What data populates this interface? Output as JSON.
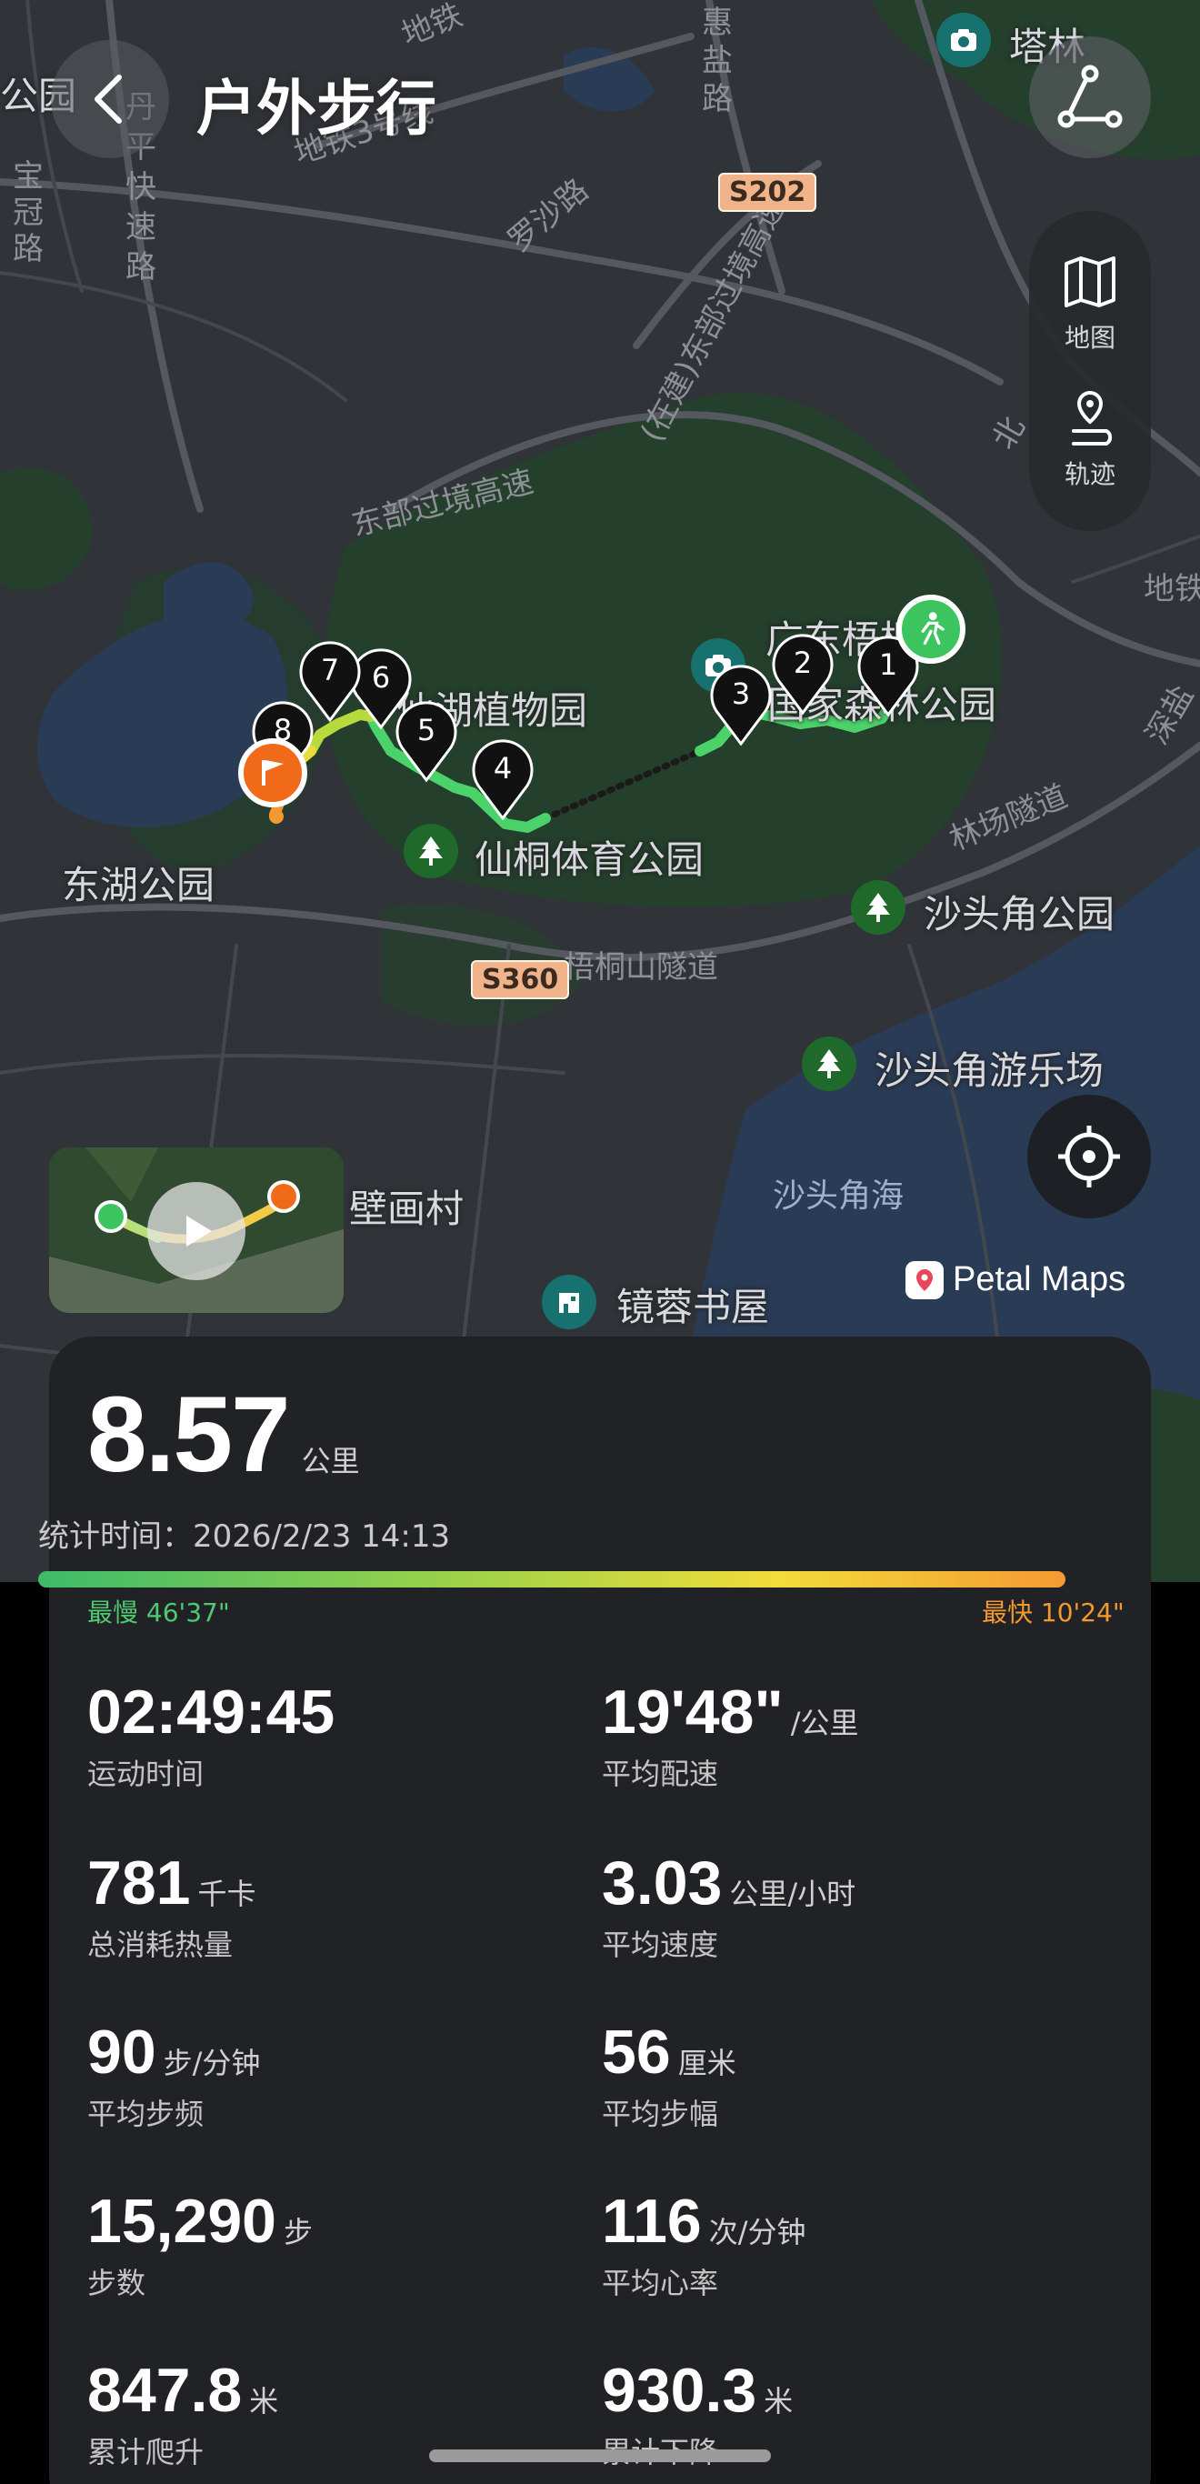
{
  "header": {
    "title": "户外步行"
  },
  "side_panel": {
    "map_label": "地图",
    "track_label": "轨迹"
  },
  "map": {
    "places": {
      "talin": "塔林",
      "guangdong_wutong": "广东梧桐山",
      "national_park": "国家森林公园",
      "xianhu": "仙湖植物园",
      "xiantong": "仙桐体育公园",
      "donghu": "东湖公园",
      "shatoujiao_park": "沙头角公园",
      "shatoujiao_amuse": "沙头角游乐场",
      "bihua": "壁画村",
      "jingrong": "镜蓉书屋",
      "gongyuan_left": "公园"
    },
    "roads": {
      "metro3": "地铁3号线",
      "metro_top": "地铁",
      "danping": "丹平快速路",
      "baoguan": "宝冠路",
      "huiyan": "惠盐路",
      "luoshazhe": "罗沙路",
      "dongbu_building": "(在建)东部过境高速",
      "dongbu": "东部过境高速",
      "linchang": "林场隧道",
      "wutong_tunnel": "梧桐山隧道",
      "shenyan": "深盐",
      "north": "北",
      "di": "地铁"
    },
    "water": {
      "shatoujiao_sea": "沙头角海"
    },
    "shields": {
      "s202": "S202",
      "s360": "S360"
    },
    "km_markers": [
      "1",
      "2",
      "3",
      "4",
      "5",
      "6",
      "7",
      "8"
    ],
    "attribution": "Petal Maps"
  },
  "stats": {
    "distance_value": "8.57",
    "distance_unit": "公里",
    "stat_time": "统计时间：2026/2/23 14:13",
    "pace_slowest": "最慢 46'37\"",
    "pace_fastest": "最快 10'24\"",
    "metrics": [
      {
        "value": "02:49:45",
        "unit": "",
        "label": "运动时间"
      },
      {
        "value": "19'48\"",
        "unit": "/公里",
        "label": "平均配速"
      },
      {
        "value": "781",
        "unit": "千卡",
        "label": "总消耗热量"
      },
      {
        "value": "3.03",
        "unit": "公里/小时",
        "label": "平均速度"
      },
      {
        "value": "90",
        "unit": "步/分钟",
        "label": "平均步频"
      },
      {
        "value": "56",
        "unit": "厘米",
        "label": "平均步幅"
      },
      {
        "value": "15,290",
        "unit": "步",
        "label": "步数"
      },
      {
        "value": "116",
        "unit": "次/分钟",
        "label": "平均心率"
      },
      {
        "value": "847.8",
        "unit": "米",
        "label": "累计爬升"
      },
      {
        "value": "930.3",
        "unit": "米",
        "label": "累计下降"
      }
    ]
  },
  "colors": {
    "track_green": "#4cd26a",
    "track_yellow": "#e8dc3a",
    "track_orange": "#f39a2e",
    "card_bg": "#212225",
    "forest": "#243f2c",
    "water": "#2a3b55"
  }
}
